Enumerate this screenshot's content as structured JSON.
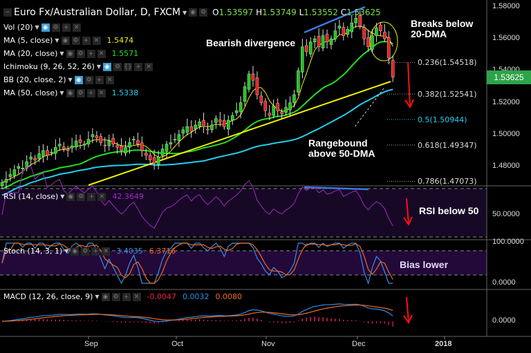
{
  "header": {
    "symbol": "Euro Fx/Australian Dollar, D, FXCM",
    "o_label": "O",
    "o": "1.53597",
    "h_label": "H",
    "h": "1.53749",
    "l_label": "L",
    "l": "1.53552",
    "c_label": "C",
    "c": "1.53625"
  },
  "indicators": [
    {
      "label": "Vol (20)",
      "value": ""
    },
    {
      "label": "MA (5, close)",
      "value": "1.5474",
      "color": "#f0f000"
    },
    {
      "label": "MA (20, close)",
      "value": "1.5571",
      "color": "#22e022"
    },
    {
      "label": "Ichimoku (9, 26, 52, 26)",
      "value": ""
    },
    {
      "label": "BB (20, close, 2)",
      "value": ""
    },
    {
      "label": "MA (50, close)",
      "value": "1.5338",
      "color": "#22d0f0"
    }
  ],
  "rsi": {
    "label": "RSI (14, close)",
    "value": "42.3649",
    "axis": "50.0000"
  },
  "stoch": {
    "label": "Stoch (14, 3, 1)",
    "k": "3.4035",
    "d": "6.3716",
    "axis_top": "100.0000",
    "axis_bottom": "0.0000"
  },
  "macd": {
    "label": "MACD (12, 26, close, 9)",
    "hist": "-0.0047",
    "macd": "0.0032",
    "signal": "0.0080",
    "axis": "0.0000"
  },
  "annotations": {
    "bearish": "Bearish divergence",
    "breaks1": "Breaks below",
    "breaks2": "20-DMA",
    "range1": "Rangebound",
    "range2": "above 50-DMA",
    "rsi": "RSI below 50",
    "bias": "Bias lower"
  },
  "fib": [
    {
      "label": "0.236(1.54518)",
      "price": 1.54518
    },
    {
      "label": "0.382(1.52541)",
      "price": 1.52541
    },
    {
      "label": "0.5(1.50944)",
      "price": 1.50944
    },
    {
      "label": "0.618(1.49347)",
      "price": 1.49347
    },
    {
      "label": "0.786(1.47073)",
      "price": 1.47073
    }
  ],
  "price_axis": [
    "1.58000",
    "1.56000",
    "1.54000",
    "1.52000",
    "1.50000",
    "1.48000"
  ],
  "current_price": "1.53625",
  "time_axis": [
    "Sep",
    "Oct",
    "Nov",
    "Dec",
    "2018"
  ],
  "chart_data": {
    "type": "candlestick",
    "title": "Euro Fx/Australian Dollar, D, FXCM",
    "ylim": [
      1.47,
      1.585
    ],
    "closes": [
      1.47,
      1.472,
      1.475,
      1.478,
      1.48,
      1.479,
      1.483,
      1.486,
      1.484,
      1.488,
      1.49,
      1.487,
      1.489,
      1.492,
      1.494,
      1.491,
      1.49,
      1.493,
      1.496,
      1.495,
      1.494,
      1.497,
      1.5,
      1.498,
      1.495,
      1.493,
      1.496,
      1.494,
      1.492,
      1.49,
      1.492,
      1.495,
      1.497,
      1.494,
      1.49,
      1.487,
      1.484,
      1.482,
      1.486,
      1.491,
      1.494,
      1.495,
      1.497,
      1.5,
      1.503,
      1.505,
      1.502,
      1.506,
      1.508,
      1.505,
      1.503,
      1.506,
      1.51,
      1.508,
      1.505,
      1.509,
      1.512,
      1.515,
      1.52,
      1.53,
      1.538,
      1.534,
      1.525,
      1.52,
      1.515,
      1.512,
      1.518,
      1.515,
      1.513,
      1.517,
      1.52,
      1.525,
      1.54,
      1.555,
      1.552,
      1.558,
      1.56,
      1.555,
      1.562,
      1.558,
      1.56,
      1.565,
      1.568,
      1.562,
      1.566,
      1.57,
      1.573,
      1.568,
      1.56,
      1.555,
      1.562,
      1.567,
      1.565,
      1.56,
      1.548,
      1.536
    ],
    "colors": {
      "up": "#22c022",
      "down": "#e02020",
      "ma5": "#f0f000",
      "ma20": "#22e022",
      "ma50": "#22d0f0",
      "trend": "#f0f000",
      "divergence": "#3a7ae0"
    }
  }
}
